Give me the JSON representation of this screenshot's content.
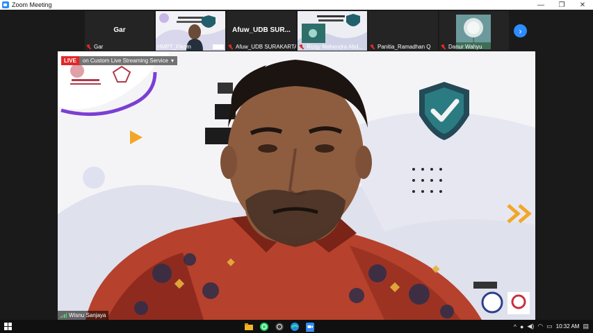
{
  "window": {
    "title": "Zoom Meeting"
  },
  "window_controls": {
    "minimize": "—",
    "maximize": "❐",
    "close": "✕"
  },
  "participants": [
    {
      "label": "Gar",
      "big_name": "Gar",
      "has_video": false
    },
    {
      "label": "HMPT_Fikom",
      "has_video": true
    },
    {
      "label": "Afuw_UDB SURAKARTA",
      "big_name": "Afuw_UDB  SUR...",
      "has_video": false
    },
    {
      "label": "Rizqy Mahendra Abd...",
      "has_video": true
    },
    {
      "label": "Panitia_Ramadhan Q",
      "has_video": false
    },
    {
      "label": "Danur Wahyu",
      "has_video": true
    }
  ],
  "strip_next_icon": "chevron-right-icon",
  "main_video": {
    "live_label": "LIVE",
    "stream_service": "on Custom Live Streaming Service",
    "speaker_name": "Wisnu Sanjaya"
  },
  "taskbar": {
    "time": "10:32 AM",
    "apps": [
      "folder-icon",
      "whatsapp-icon",
      "obs-icon",
      "edge-icon",
      "zoom-icon"
    ]
  },
  "colors": {
    "accent": "#2d8cff",
    "live": "#e02828",
    "muted": "#e02828"
  }
}
